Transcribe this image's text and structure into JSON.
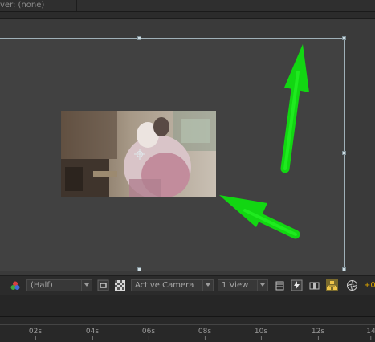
{
  "header": {
    "layer_label": "ver: (none)"
  },
  "viewer": {
    "resolution": "(Half)",
    "camera": "Active Camera",
    "views": "1 View",
    "exposure": "+0"
  },
  "timeline": {
    "ticks": [
      "02s",
      "04s",
      "06s",
      "08s",
      "10s",
      "12s",
      "14"
    ]
  },
  "colors": {
    "arrow": "#19e619",
    "comp_border": "#9fb0b8",
    "exposure_text": "#d8a200"
  },
  "icons": [
    "color-channels-icon",
    "region-of-interest-icon",
    "transparency-grid-icon",
    "grid-icon",
    "fast-preview-icon",
    "timeline-icon",
    "flowchart-icon",
    "shutter-icon"
  ]
}
